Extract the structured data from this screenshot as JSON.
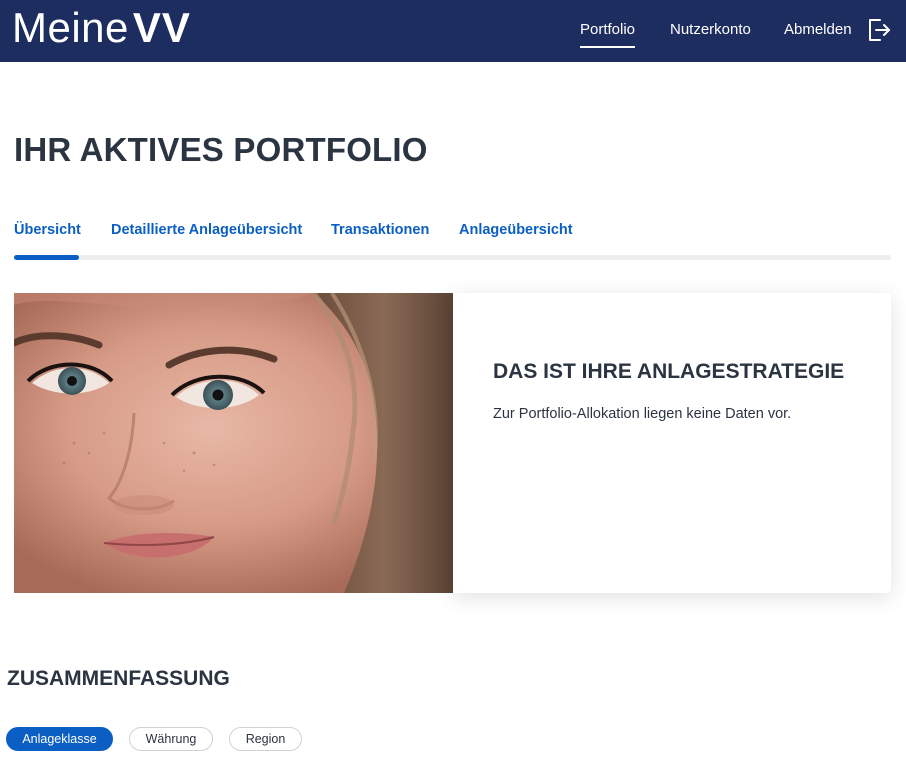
{
  "header": {
    "brand_light": "Meine",
    "brand_bold": "VV",
    "nav": {
      "portfolio": "Portfolio",
      "account": "Nutzerkonto",
      "logout": "Abmelden"
    },
    "background_color": "#1e2d5f",
    "logout_icon": "logout-icon"
  },
  "page": {
    "title": "IHR AKTIVES PORTFOLIO"
  },
  "tabs": [
    {
      "label": "Übersicht",
      "active": true
    },
    {
      "label": "Detaillierte Anlageübersicht",
      "active": false
    },
    {
      "label": "Transaktionen",
      "active": false
    },
    {
      "label": "Anlageübersicht",
      "active": false
    }
  ],
  "accent_color": "#0b5fc4",
  "strategy": {
    "image": "portrait-photo",
    "title": "DAS IST IHRE ANLAGESTRATEGIE",
    "text": "Zur Portfolio-Allokation liegen keine Daten vor."
  },
  "summary": {
    "title": "ZUSAMMENFASSUNG",
    "filters": [
      {
        "label": "Anlageklasse",
        "active": true
      },
      {
        "label": "Währung",
        "active": false
      },
      {
        "label": "Region",
        "active": false
      }
    ]
  }
}
